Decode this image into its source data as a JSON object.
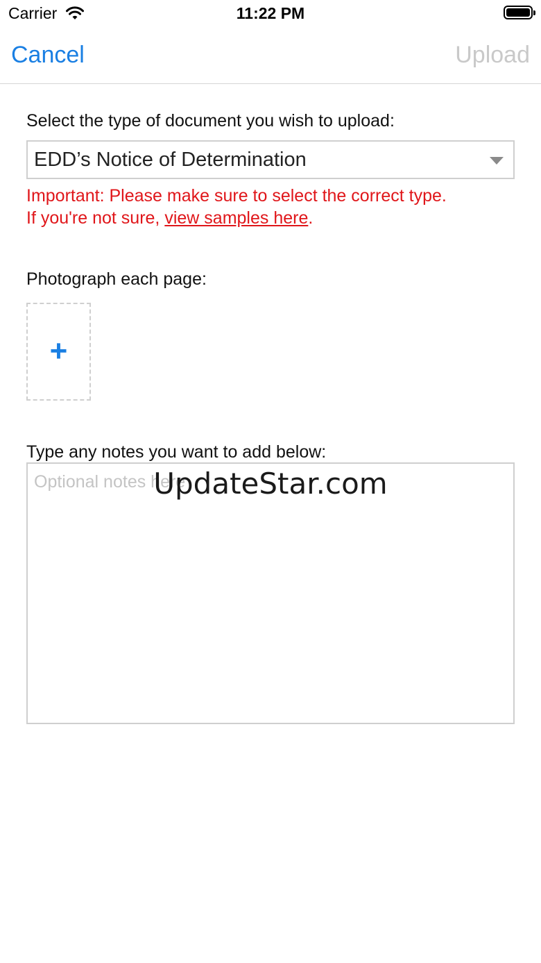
{
  "status_bar": {
    "carrier": "Carrier",
    "time": "11:22 PM",
    "icons": [
      "wifi-icon",
      "battery-icon"
    ]
  },
  "nav": {
    "cancel_label": "Cancel",
    "upload_label": "Upload",
    "accent_color": "#1a7fe3",
    "disabled_color": "#c9c9c9"
  },
  "form": {
    "doc_type_label": "Select the type of document you wish to upload:",
    "doc_type_value": "EDD’s Notice of Determination",
    "warning_line1": "Important: Please make sure to select the correct type.",
    "warning_line2_prefix": "If you're not sure, ",
    "warning_link": "view samples here",
    "warning_line2_suffix": ".",
    "warning_color": "#e0161a",
    "photo_label": "Photograph each page:",
    "add_photo_icon": "plus-icon",
    "add_photo_symbol": "+",
    "notes_label": "Type any notes you want to add below:",
    "notes_placeholder": "Optional notes here",
    "notes_value": ""
  },
  "watermark": {
    "text": "UpdateStar.com"
  }
}
